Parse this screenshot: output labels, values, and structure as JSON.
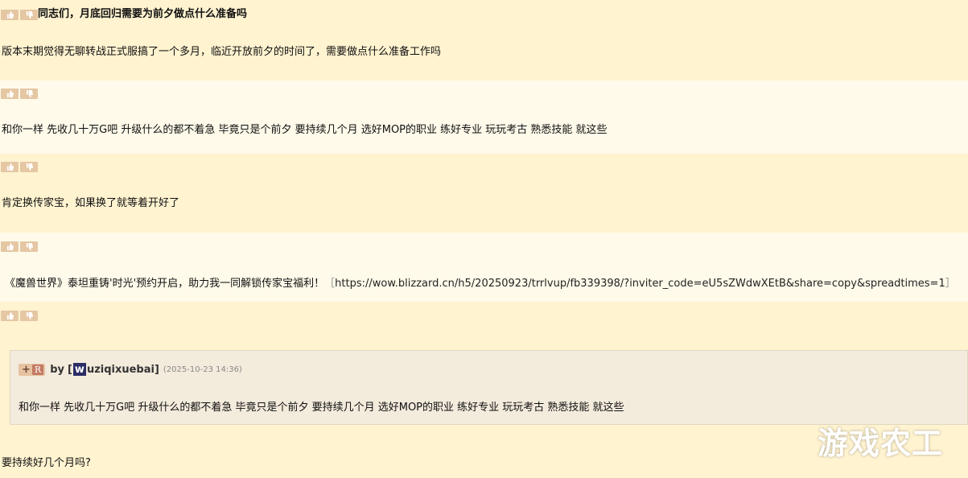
{
  "posts": [
    {
      "title": "同志们，月底回归需要为前夕做点什么准备吗",
      "body": "版本末期觉得无聊转战正式服搞了一个多月，临近开放前夕的时间了，需要做点什么准备工作吗"
    },
    {
      "body": "和你一样 先收几十万G吧 升级什么的都不着急 毕竟只是个前夕 要持续几个月 选好MOP的职业 练好专业 玩玩考古 熟悉技能 就这些"
    },
    {
      "body": "肯定换传家宝，如果换了就等着开好了"
    },
    {
      "body": "《魔兽世界》泰坦重铸'时光'预约开启，助力我一同解锁传家宝福利！",
      "link_open": "［",
      "link": "https://wow.blizzard.cn/h5/20250923/trrlvup/fb339398/?inviter_code=eU5sZWdwXEtB&share=copy&spreadtimes=1",
      "link_close": "］"
    },
    {
      "quote": {
        "plus": "+",
        "r_badge": "R",
        "by": "by",
        "open": "[",
        "avatar_letter": "w",
        "username": "uziqixuebai",
        "close": "]",
        "timestamp": "(2025-10-23 14:36)",
        "body": "和你一样 先收几十万G吧 升级什么的都不着急 毕竟只是个前夕 要持续几个月 选好MOP的职业 练好专业 玩玩考古 熟悉技能 就这些"
      },
      "reply": "要持续好几个月吗?"
    }
  ],
  "icons": {
    "upvote": "thumbs-up-icon",
    "downvote": "thumbs-down-icon"
  },
  "colors": {
    "odd_bg": "#fff3d0",
    "even_bg": "#fffaea",
    "vote_btn": "#e5c7a4",
    "quote_bg": "#f3ebdc",
    "avatar_bg": "#2c2c66"
  },
  "watermark": "游戏农工"
}
